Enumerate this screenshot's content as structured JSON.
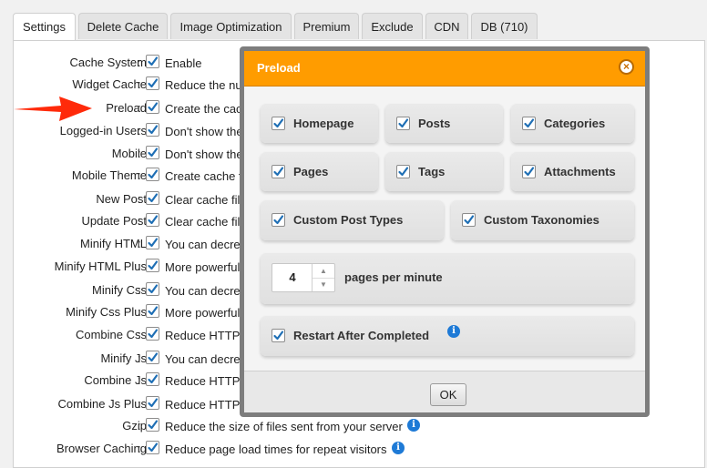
{
  "tabs": [
    "Settings",
    "Delete Cache",
    "Image Optimization",
    "Premium",
    "Exclude",
    "CDN",
    "DB (710)"
  ],
  "settings": [
    {
      "label": "Cache System",
      "desc": "Enable"
    },
    {
      "label": "Widget Cache",
      "desc": "Reduce the num"
    },
    {
      "label": "Preload",
      "desc": "Create the cach"
    },
    {
      "label": "Logged-in Users",
      "desc": "Don't show the"
    },
    {
      "label": "Mobile",
      "desc": "Don't show the"
    },
    {
      "label": "Mobile Theme",
      "desc": "Create cache fo"
    },
    {
      "label": "New Post",
      "desc": "Clear cache file"
    },
    {
      "label": "Update Post",
      "desc": "Clear cache file"
    },
    {
      "label": "Minify HTML",
      "desc": "You can decrea"
    },
    {
      "label": "Minify HTML Plus",
      "desc": "More powerful m"
    },
    {
      "label": "Minify Css",
      "desc": "You can decrea"
    },
    {
      "label": "Minify Css Plus",
      "desc": "More powerful m"
    },
    {
      "label": "Combine Css",
      "desc": "Reduce HTTP re"
    },
    {
      "label": "Minify Js",
      "desc": "You can decrea"
    },
    {
      "label": "Combine Js",
      "desc": "Reduce HTTP re"
    },
    {
      "label": "Combine Js Plus",
      "desc": " Reduce HTTP r"
    },
    {
      "label": "Gzip",
      "desc": "Reduce the size of files sent from your server"
    },
    {
      "label": "Browser Caching",
      "desc": "Reduce page load times for repeat visitors"
    }
  ],
  "modal": {
    "title": "Preload",
    "close_glyph": "×",
    "options": [
      "Homepage",
      "Posts",
      "Categories",
      "Pages",
      "Tags",
      "Attachments",
      "Custom Post Types",
      "Custom Taxonomies"
    ],
    "rate_value": "4",
    "rate_label": "pages per minute",
    "restart_label": "Restart After Completed",
    "ok_label": "OK"
  },
  "colors": {
    "modal_header": "#ff9c00",
    "info_icon": "#1e7ad6",
    "arrow": "#ff2a0a"
  }
}
